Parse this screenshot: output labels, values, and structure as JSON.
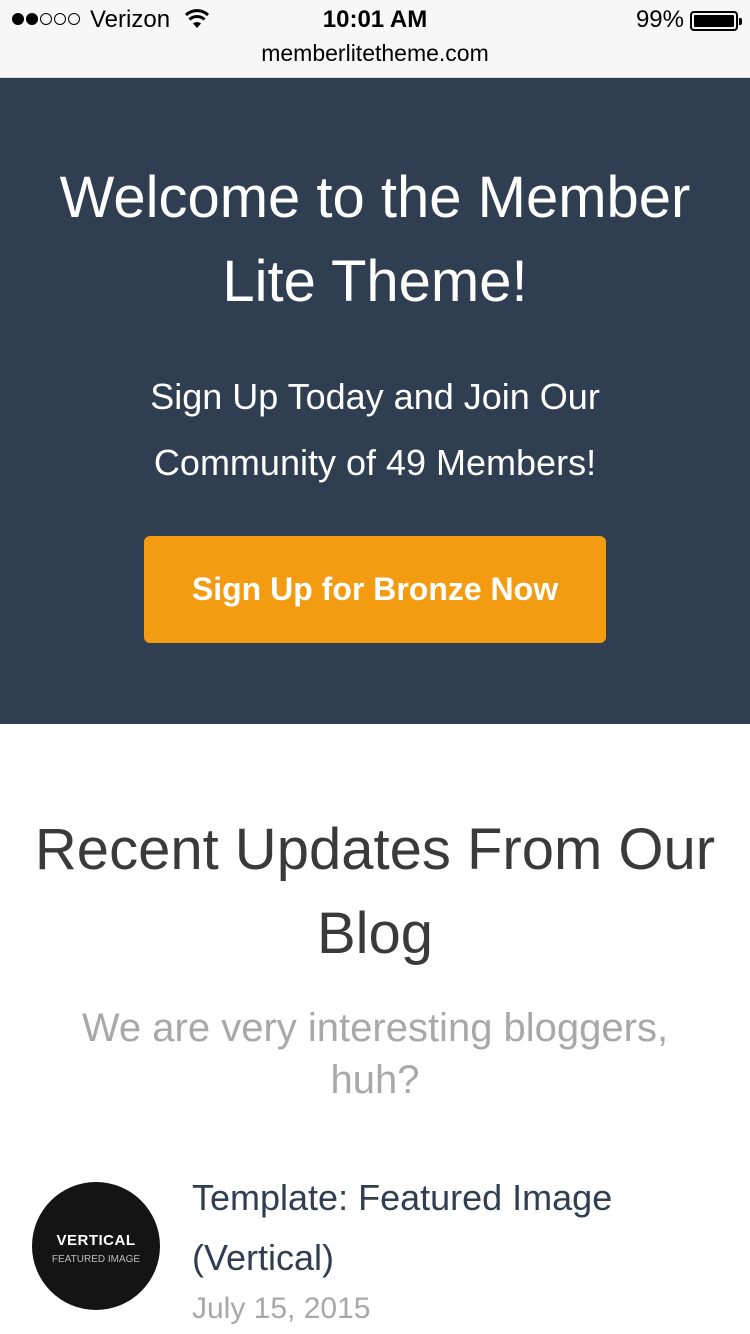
{
  "status_bar": {
    "carrier": "Verizon",
    "time": "10:01 AM",
    "battery": "99%",
    "battery_level": 0.99
  },
  "browser": {
    "url": "memberlitetheme.com"
  },
  "hero": {
    "title": "Welcome to the Member Lite Theme!",
    "subtitle": "Sign Up Today and Join Our Community of 49 Members!",
    "cta_label": "Sign Up for Bronze Now"
  },
  "blog": {
    "title": "Recent Updates From Our Blog",
    "subtitle": "We are very interesting bloggers, huh?",
    "posts": [
      {
        "title": "Template: Featured Image (Vertical)",
        "date": "July 15, 2015",
        "thumb_line1": "VERTICAL",
        "thumb_line2": "FEATURED IMAGE"
      }
    ]
  },
  "colors": {
    "hero_background": "#2f3e51",
    "cta_background": "#f39c12",
    "post_title": "#2f3e51",
    "muted_text": "#a8a8a8"
  }
}
